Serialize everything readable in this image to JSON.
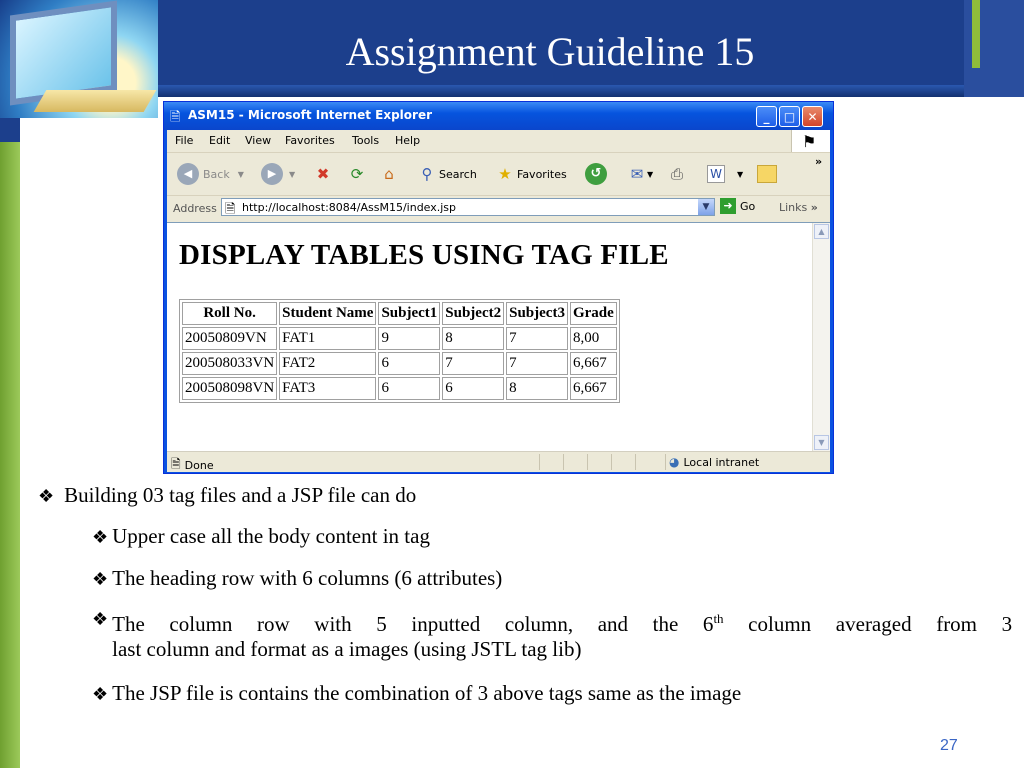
{
  "slide": {
    "title": "Assignment Guideline 15",
    "page_number": "27",
    "bullets": {
      "main": "Building 03 tag files and a JSP file can do",
      "sub": [
        {
          "text": "Upper case all the body content in tag"
        },
        {
          "text": "The heading row with 6 columns (6 attributes)"
        },
        {
          "text_before": "The column row with 5 inputted column, and the 6",
          "sup": "th",
          "text_after": " column averaged from 3",
          "line2": "last column and format as a images (using JSTL tag lib)"
        },
        {
          "text": "The JSP file is contains the combination of 3 above tags same as the image"
        }
      ]
    }
  },
  "browser": {
    "title": "ASM15 - Microsoft Internet Explorer",
    "menu": [
      "File",
      "Edit",
      "View",
      "Favorites",
      "Tools",
      "Help"
    ],
    "toolbar": {
      "back": "Back",
      "search": "Search",
      "favorites": "Favorites",
      "more": "»"
    },
    "address": {
      "label": "Address",
      "url": "http://localhost:8084/AssM15/index.jsp",
      "go": "Go",
      "links": "Links",
      "more": "»"
    },
    "page": {
      "heading": "DISPLAY TABLES USING TAG FILE",
      "table": {
        "headers": [
          "Roll No.",
          "Student Name",
          "Subject1",
          "Subject2",
          "Subject3",
          "Grade"
        ],
        "rows": [
          [
            "20050809VN",
            "FAT1",
            "9",
            "8",
            "7",
            "8,00"
          ],
          [
            "200508033VN",
            "FAT2",
            "6",
            "7",
            "7",
            "6,667"
          ],
          [
            "200508098VN",
            "FAT3",
            "6",
            "6",
            "8",
            "6,667"
          ]
        ]
      }
    },
    "status": {
      "text": "Done",
      "zone": "Local intranet"
    }
  },
  "icons": [
    "ie-page-icon",
    "minimize-icon",
    "maximize-icon",
    "close-icon",
    "windows-flag-icon",
    "back-icon",
    "forward-icon",
    "stop-icon",
    "refresh-icon",
    "home-icon",
    "search-icon",
    "favorites-star-icon",
    "history-icon",
    "mail-icon",
    "print-icon",
    "edit-icon",
    "folder-icon",
    "go-arrow-icon",
    "zone-icon",
    "diamond-bullet-icon"
  ]
}
